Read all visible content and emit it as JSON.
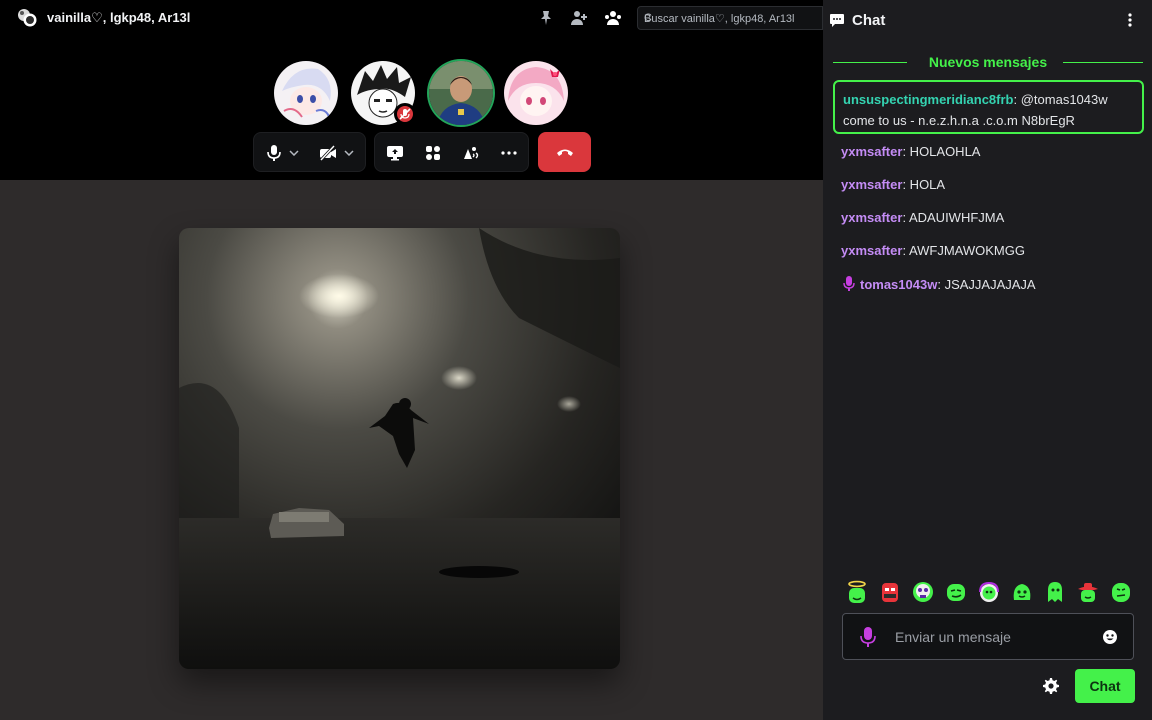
{
  "call": {
    "title": "vainilla♡, lgkp48, Ar13l",
    "search_placeholder": "Buscar vainilla♡, lgkp48, Ar13l",
    "search_overflow": "C",
    "toolbar_icons": [
      "pin-icon",
      "add-friend-icon",
      "members-icon"
    ],
    "participants": [
      {
        "name": "participant-1",
        "speaking": false,
        "muted": false
      },
      {
        "name": "participant-2",
        "speaking": false,
        "muted": true
      },
      {
        "name": "participant-3",
        "speaking": true,
        "muted": false
      },
      {
        "name": "participant-4",
        "speaking": false,
        "muted": false
      }
    ],
    "controls": [
      "microphone",
      "camera-off",
      "screen-share",
      "activities",
      "soundboard",
      "more"
    ],
    "colors": {
      "hangup": "#da373c",
      "speaking": "#23a55a"
    }
  },
  "chat": {
    "title": "Chat",
    "new_messages_label": "Nuevos mensajes",
    "highlight": {
      "author": "unsuspectingmeridianc8frb",
      "separator": ":",
      "text": " @tomas1043w come to us - n.e.z.h.n.a .c.o.m N8brEgR"
    },
    "messages": [
      {
        "author": "yxmsafter",
        "text": " HOLAOHLA",
        "mic": false
      },
      {
        "author": "yxmsafter",
        "text": " HOLA",
        "mic": false
      },
      {
        "author": "yxmsafter",
        "text": " ADAUIWHFJMA",
        "mic": false
      },
      {
        "author": "yxmsafter",
        "text": " AWFJMAWOKMGG",
        "mic": false
      },
      {
        "author": "tomas1043w",
        "text": " JSAJJAJAJAJA",
        "mic": true
      }
    ],
    "input_placeholder": "Enviar un mensaje",
    "send_label": "Chat",
    "colors": {
      "accent": "#44f14a",
      "author_teal": "#34d3b1",
      "author_purple": "#c48cf5"
    }
  }
}
